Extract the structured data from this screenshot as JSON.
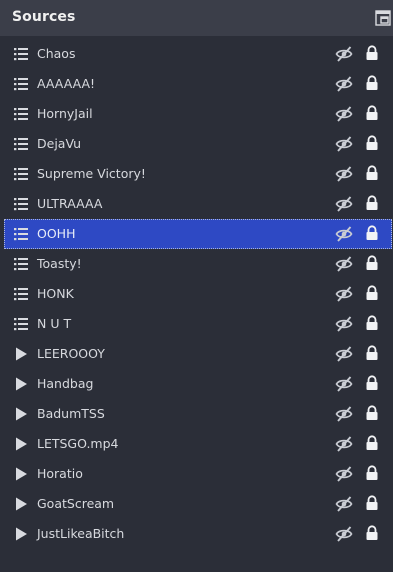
{
  "dock": {
    "title": "Sources"
  },
  "theme": {
    "panel_bg": "#2b2e38",
    "header_bg": "#3b3e49",
    "selection_bg": "#2e49c4",
    "text": "#d7d9de",
    "icon": "#d9dbe0"
  },
  "sources": [
    {
      "label": "Chaos",
      "type_icon": "group-list-icon",
      "visible": false,
      "locked": true,
      "selected": false
    },
    {
      "label": "AAAAAA!",
      "type_icon": "group-list-icon",
      "visible": false,
      "locked": true,
      "selected": false
    },
    {
      "label": "HornyJail",
      "type_icon": "group-list-icon",
      "visible": false,
      "locked": true,
      "selected": false
    },
    {
      "label": "DejaVu",
      "type_icon": "group-list-icon",
      "visible": false,
      "locked": true,
      "selected": false
    },
    {
      "label": "Supreme Victory!",
      "type_icon": "group-list-icon",
      "visible": false,
      "locked": true,
      "selected": false
    },
    {
      "label": "ULTRAAAA",
      "type_icon": "group-list-icon",
      "visible": false,
      "locked": true,
      "selected": false
    },
    {
      "label": "OOHH",
      "type_icon": "group-list-icon",
      "visible": false,
      "locked": true,
      "selected": true
    },
    {
      "label": "Toasty!",
      "type_icon": "group-list-icon",
      "visible": false,
      "locked": true,
      "selected": false
    },
    {
      "label": "HONK",
      "type_icon": "group-list-icon",
      "visible": false,
      "locked": true,
      "selected": false
    },
    {
      "label": "N U T",
      "type_icon": "group-list-icon",
      "visible": false,
      "locked": true,
      "selected": false
    },
    {
      "label": "LEEROOOY",
      "type_icon": "media-play-icon",
      "visible": false,
      "locked": true,
      "selected": false
    },
    {
      "label": "Handbag",
      "type_icon": "media-play-icon",
      "visible": false,
      "locked": true,
      "selected": false
    },
    {
      "label": "BadumTSS",
      "type_icon": "media-play-icon",
      "visible": false,
      "locked": true,
      "selected": false
    },
    {
      "label": "LETSGO.mp4",
      "type_icon": "media-play-icon",
      "visible": false,
      "locked": true,
      "selected": false
    },
    {
      "label": "Horatio",
      "type_icon": "media-play-icon",
      "visible": false,
      "locked": true,
      "selected": false
    },
    {
      "label": "GoatScream",
      "type_icon": "media-play-icon",
      "visible": false,
      "locked": true,
      "selected": false
    },
    {
      "label": "JustLikeaBitch",
      "type_icon": "media-play-icon",
      "visible": false,
      "locked": true,
      "selected": false
    }
  ]
}
